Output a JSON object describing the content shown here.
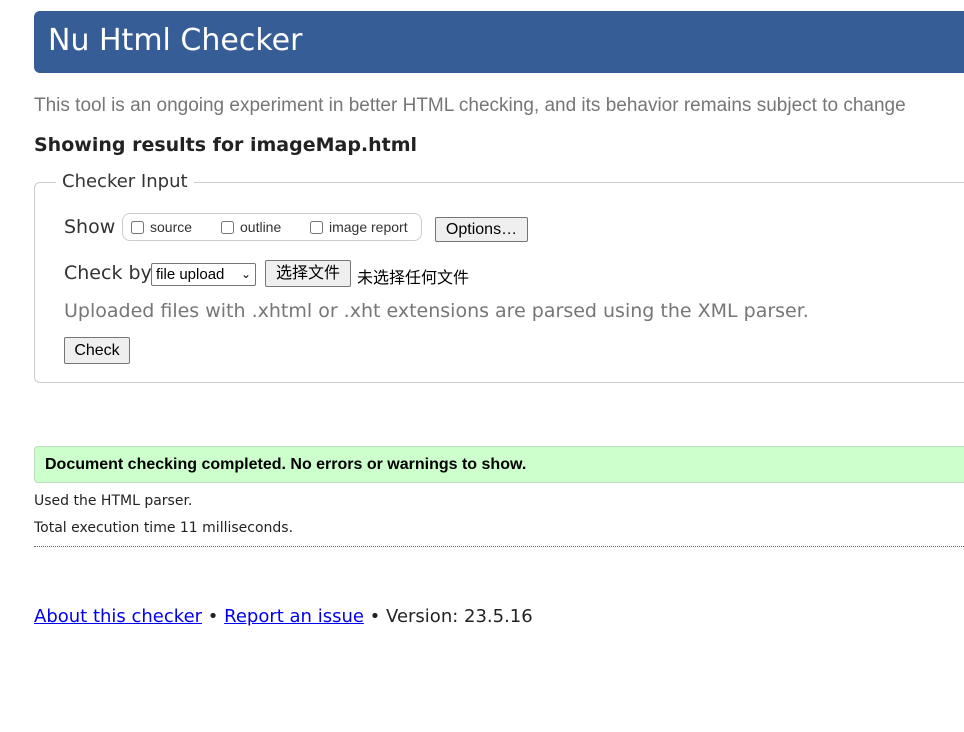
{
  "header": {
    "title": "Nu Html Checker"
  },
  "tagline": "This tool is an ongoing experiment in better HTML checking, and its behavior remains subject to change",
  "results_heading": "Showing results for imageMap.html",
  "checker_input": {
    "legend": "Checker Input",
    "show_label": "Show",
    "show_options": [
      {
        "label": "source",
        "checked": false
      },
      {
        "label": "outline",
        "checked": false
      },
      {
        "label": "image report",
        "checked": false
      }
    ],
    "options_button": "Options…",
    "check_by_label": "Check by",
    "check_by_selected": "file upload",
    "file_button": "选择文件",
    "file_status": "未选择任何文件",
    "hint": "Uploaded files with .xhtml or .xht extensions are parsed using the XML parser.",
    "check_button": "Check"
  },
  "result": {
    "message": "Document checking completed. No errors or warnings to show.",
    "parser_note": "Used the HTML parser.",
    "execution_time": "Total execution time 11 milliseconds."
  },
  "footer": {
    "about_link": "About this checker",
    "separator": "•",
    "report_link": "Report an issue",
    "version": "Version: 23.5.16"
  },
  "colors": {
    "header_bg": "#365d95",
    "success_bg": "#ccffcc",
    "link": "#0000ee"
  }
}
